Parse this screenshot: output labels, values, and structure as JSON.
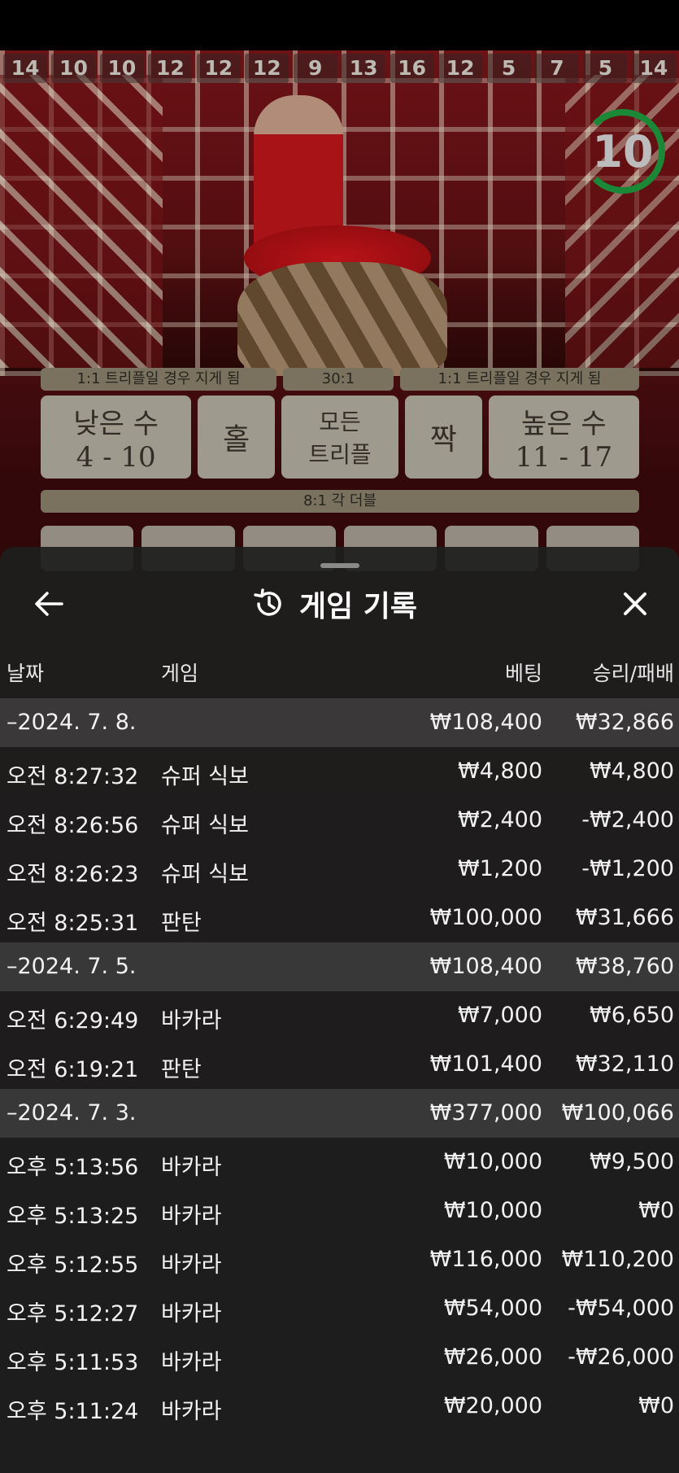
{
  "results_history": [
    "14",
    "10",
    "10",
    "12",
    "12",
    "12",
    "9",
    "13",
    "16",
    "12",
    "5",
    "7",
    "5",
    "14"
  ],
  "timer": {
    "value": "10"
  },
  "bet_board": {
    "payouts_top": [
      "1:1 트리플일 경우 지게 됨",
      "30:1",
      "1:1 트리플일 경우 지게 됨"
    ],
    "small": {
      "label": "낮은 수",
      "range": "4 - 10"
    },
    "odd": {
      "label": "홀"
    },
    "any_triple": {
      "line1": "모든",
      "line2": "트리플"
    },
    "even": {
      "label": "짝"
    },
    "big": {
      "label": "높은 수",
      "range": "11 - 17"
    },
    "double_payout": "8:1 각 더블"
  },
  "sheet": {
    "title": "게임 기록",
    "columns": {
      "date": "날짜",
      "game": "게임",
      "bet": "베팅",
      "win_loss": "승리/패배"
    },
    "rows": [
      {
        "type": "group",
        "date": "–2024. 7. 8.",
        "game": "",
        "bet": "₩108,400",
        "win": "₩32,866"
      },
      {
        "type": "item",
        "date": "오전 8:27:32",
        "game": "슈퍼 식보",
        "bet": "₩4,800",
        "win": "₩4,800"
      },
      {
        "type": "item",
        "date": "오전 8:26:56",
        "game": "슈퍼 식보",
        "bet": "₩2,400",
        "win": "-₩2,400"
      },
      {
        "type": "item",
        "date": "오전 8:26:23",
        "game": "슈퍼 식보",
        "bet": "₩1,200",
        "win": "-₩1,200"
      },
      {
        "type": "item",
        "date": "오전 8:25:31",
        "game": "판탄",
        "bet": "₩100,000",
        "win": "₩31,666"
      },
      {
        "type": "group",
        "date": "–2024. 7. 5.",
        "game": "",
        "bet": "₩108,400",
        "win": "₩38,760"
      },
      {
        "type": "item",
        "date": "오전 6:29:49",
        "game": "바카라",
        "bet": "₩7,000",
        "win": "₩6,650"
      },
      {
        "type": "item",
        "date": "오전 6:19:21",
        "game": "판탄",
        "bet": "₩101,400",
        "win": "₩32,110"
      },
      {
        "type": "group",
        "date": "–2024. 7. 3.",
        "game": "",
        "bet": "₩377,000",
        "win": "₩100,066"
      },
      {
        "type": "item",
        "date": "오후 5:13:56",
        "game": "바카라",
        "bet": "₩10,000",
        "win": "₩9,500"
      },
      {
        "type": "item",
        "date": "오후 5:13:25",
        "game": "바카라",
        "bet": "₩10,000",
        "win": "₩0"
      },
      {
        "type": "item",
        "date": "오후 5:12:55",
        "game": "바카라",
        "bet": "₩116,000",
        "win": "₩110,200"
      },
      {
        "type": "item",
        "date": "오후 5:12:27",
        "game": "바카라",
        "bet": "₩54,000",
        "win": "-₩54,000"
      },
      {
        "type": "item",
        "date": "오후 5:11:53",
        "game": "바카라",
        "bet": "₩26,000",
        "win": "-₩26,000"
      },
      {
        "type": "item",
        "date": "오후 5:11:24",
        "game": "바카라",
        "bet": "₩20,000",
        "win": "₩0"
      }
    ]
  },
  "colors": {
    "sheet_bg": "#1e1e1e",
    "group_row": "#3c3c3c",
    "timer_ring": "#1e9b3e"
  },
  "icons": {
    "back": "arrow-left-icon",
    "history": "history-icon",
    "close": "close-icon"
  }
}
